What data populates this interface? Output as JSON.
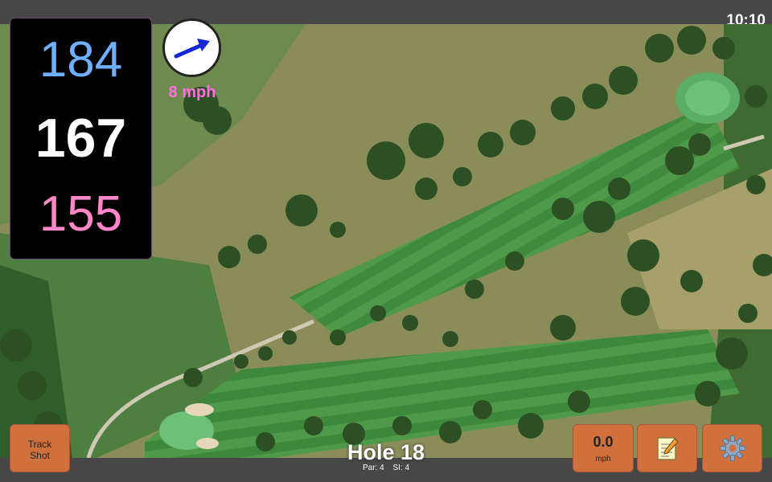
{
  "status": {
    "time": "10:10"
  },
  "distances": {
    "back": "184",
    "middle": "167",
    "front": "155"
  },
  "wind": {
    "speed": "8 mph",
    "direction_icon": "wind-arrow-icon"
  },
  "buttons": {
    "track_shot_line1": "Track",
    "track_shot_line2": "Shot",
    "speed_value": "0.0",
    "speed_unit": "mph",
    "notes_icon": "notepad-icon",
    "settings_icon": "gear-icon"
  },
  "hole": {
    "title": "Hole 18",
    "par": "Par: 4",
    "si": "SI: 4"
  },
  "colors": {
    "back_distance": "#6db0ff",
    "middle_distance": "#ffffff",
    "front_distance": "#ff86c8",
    "wind_text": "#ff6ee0",
    "button": "#d0703c"
  }
}
